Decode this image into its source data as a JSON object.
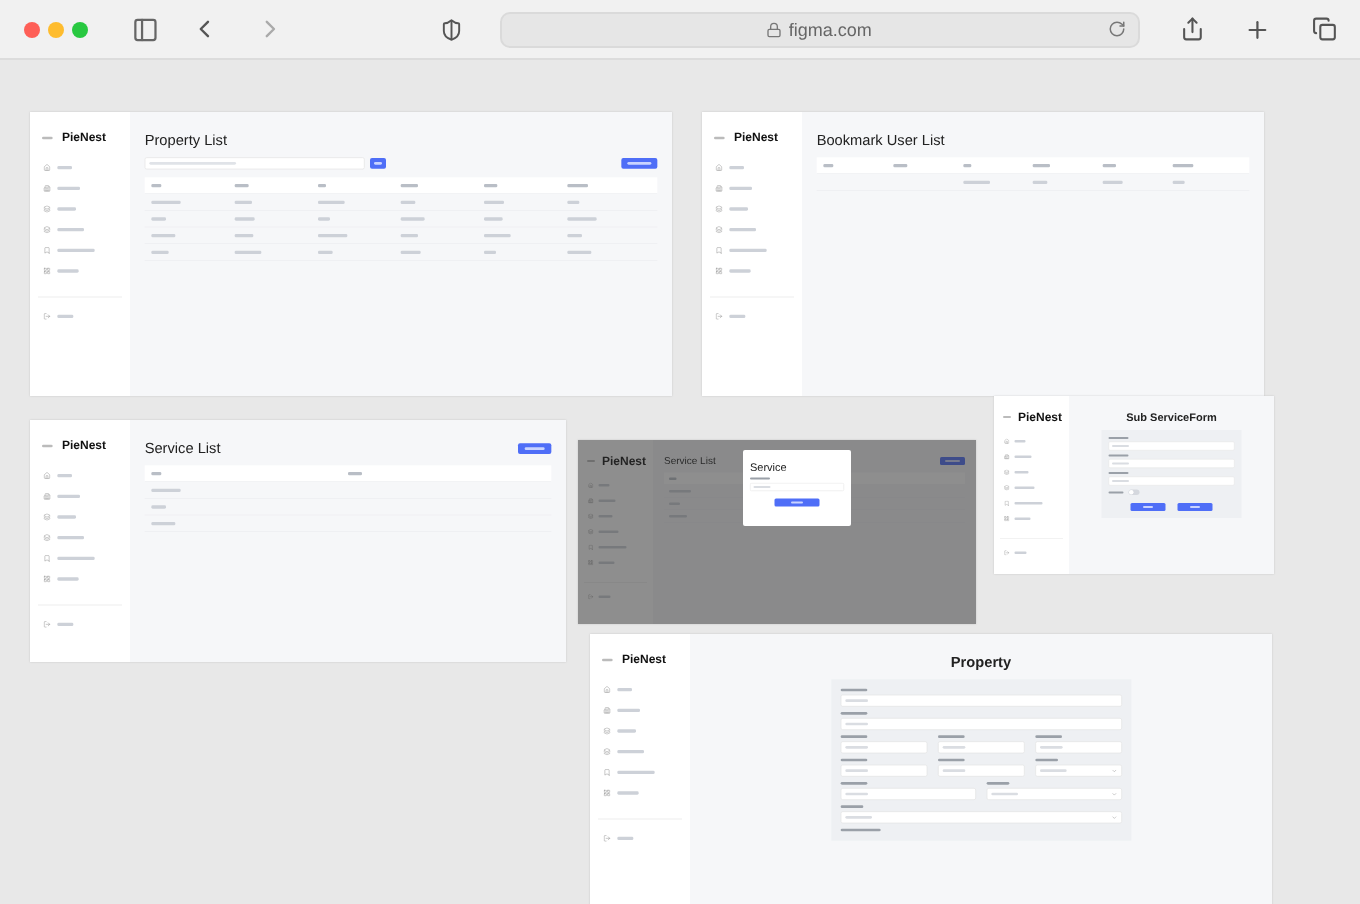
{
  "browser": {
    "url": "figma.com"
  },
  "frames": [
    {
      "kind": "list",
      "brand": "PieNest",
      "title": "Property List"
    },
    {
      "kind": "list",
      "brand": "PieNest",
      "title": "Bookmark User List"
    },
    {
      "kind": "list",
      "brand": "PieNest",
      "title": "Service List"
    },
    {
      "kind": "modal",
      "brand": "PieNest",
      "title": "Service List",
      "modal": {
        "title": "Service"
      }
    },
    {
      "kind": "form",
      "brand": "PieNest",
      "title": "Sub ServiceForm",
      "toggle": {
        "on": false
      }
    },
    {
      "kind": "form",
      "brand": "PieNest",
      "title": "Property"
    }
  ]
}
